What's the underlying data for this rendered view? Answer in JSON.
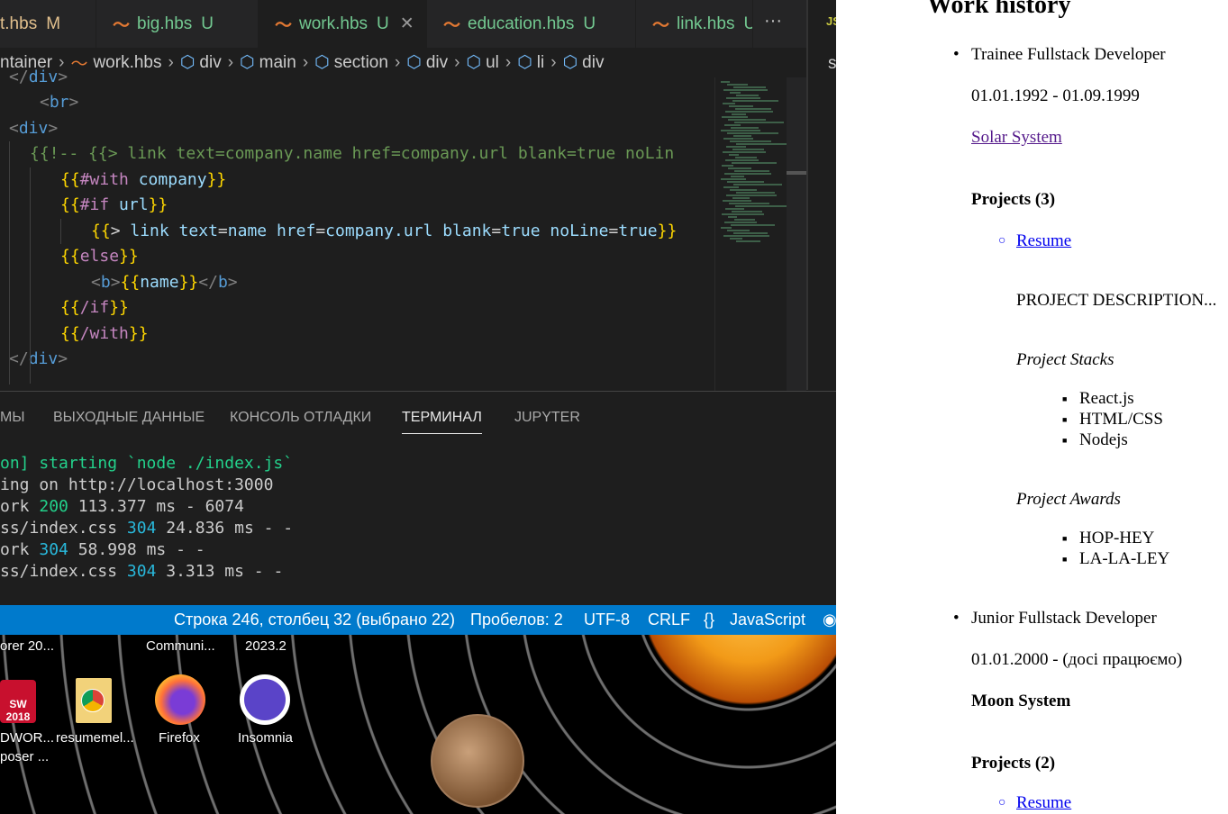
{
  "editor": {
    "tabs": [
      {
        "name": "t.hbs",
        "status": "M",
        "active": false,
        "color": "#e2c08d"
      },
      {
        "name": "big.hbs",
        "status": "U",
        "active": false
      },
      {
        "name": "work.hbs",
        "status": "U",
        "active": true
      },
      {
        "name": "education.hbs",
        "status": "U",
        "active": false
      },
      {
        "name": "link.hbs",
        "status": "U",
        "active": false
      }
    ],
    "more_icon": "ellipsis-icon",
    "close_glyph": "✕",
    "side_label": "JS",
    "side_letter": "s",
    "breadcrumbs": [
      "ntainer",
      "work.hbs",
      "div",
      "main",
      "section",
      "div",
      "ul",
      "li",
      "div"
    ],
    "code_lines": [
      {
        "indent": 1,
        "tokens": [
          [
            "br",
            "</"
          ],
          [
            "tag",
            "div"
          ],
          [
            "br",
            ">"
          ]
        ]
      },
      {
        "indent": 1,
        "tokens": [
          [
            "br",
            "<"
          ],
          [
            "tag",
            "br"
          ],
          [
            "br",
            ">"
          ]
        ]
      },
      {
        "indent": 0,
        "tokens": [
          [
            "br",
            "<"
          ],
          [
            "tag",
            "div"
          ],
          [
            "br",
            ">"
          ]
        ]
      },
      {
        "indent": 1,
        "tokens": [
          [
            "cm",
            "{{!-- {{> link text=company.name href=company.url blank=true noLin"
          ]
        ]
      },
      {
        "indent": 2,
        "tokens": [
          [
            "hb",
            "{{"
          ],
          [
            "kw",
            "#with"
          ],
          [
            "tx",
            " "
          ],
          [
            "id",
            "company"
          ],
          [
            "hb",
            "}}"
          ]
        ]
      },
      {
        "indent": 2,
        "tokens": [
          [
            "hb",
            "{{"
          ],
          [
            "kw",
            "#if"
          ],
          [
            "tx",
            " "
          ],
          [
            "id",
            "url"
          ],
          [
            "hb",
            "}}"
          ]
        ]
      },
      {
        "indent": 3,
        "tokens": [
          [
            "hb",
            "{{"
          ],
          [
            "tx",
            "> "
          ],
          [
            "id",
            "link text"
          ],
          [
            "tx",
            "="
          ],
          [
            "id",
            "name href"
          ],
          [
            "tx",
            "="
          ],
          [
            "id",
            "company.url blank"
          ],
          [
            "tx",
            "="
          ],
          [
            "id",
            "true noLine"
          ],
          [
            "tx",
            "="
          ],
          [
            "id",
            "true"
          ],
          [
            "hb",
            "}}"
          ]
        ]
      },
      {
        "indent": 2,
        "tokens": [
          [
            "hb",
            "{{"
          ],
          [
            "kw",
            "else"
          ],
          [
            "hb",
            "}}"
          ]
        ]
      },
      {
        "indent": 3,
        "tokens": [
          [
            "br",
            "<"
          ],
          [
            "tag",
            "b"
          ],
          [
            "br",
            ">"
          ],
          [
            "hb",
            "{{"
          ],
          [
            "id",
            "name"
          ],
          [
            "hb",
            "}}"
          ],
          [
            "br",
            "</"
          ],
          [
            "tag",
            "b"
          ],
          [
            "br",
            ">"
          ]
        ]
      },
      {
        "indent": 2,
        "tokens": [
          [
            "hb",
            "{{"
          ],
          [
            "kw",
            "/if"
          ],
          [
            "hb",
            "}}"
          ]
        ]
      },
      {
        "indent": 2,
        "tokens": [
          [
            "hb",
            "{{"
          ],
          [
            "kw",
            "/with"
          ],
          [
            "hb",
            "}}"
          ]
        ]
      },
      {
        "indent": 0,
        "tokens": [
          [
            "br",
            "</"
          ],
          [
            "tag",
            "div"
          ],
          [
            "br",
            ">"
          ]
        ]
      }
    ]
  },
  "panel": {
    "tabs": [
      "МЫ",
      "ВЫХОДНЫЕ ДАННЫЕ",
      "КОНСОЛЬ ОТЛАДКИ",
      "ТЕРМИНАЛ",
      "JUPYTER"
    ],
    "active_tab": "ТЕРМИНАЛ",
    "terminal": [
      [
        [
          "g",
          "on] starting `node ./index.js`"
        ]
      ],
      [
        [
          "t",
          "ing on http://localhost:3000"
        ]
      ],
      [
        [
          "t",
          "ork "
        ],
        [
          "g",
          "200"
        ],
        [
          "t",
          " 113.377 ms - 6074"
        ]
      ],
      [
        [
          "t",
          "ss/index.css "
        ],
        [
          "c",
          "304"
        ],
        [
          "t",
          " 24.836 ms - -"
        ]
      ],
      [
        [
          "t",
          "ork "
        ],
        [
          "c",
          "304"
        ],
        [
          "t",
          " 58.998 ms - -"
        ]
      ],
      [
        [
          "t",
          "ss/index.css "
        ],
        [
          "c",
          "304"
        ],
        [
          "t",
          " 3.313 ms - -"
        ]
      ]
    ]
  },
  "status_bar": {
    "position": "Строка 246, столбец 32 (выбрано 22)",
    "spaces": "Пробелов: 2",
    "encoding": "UTF-8",
    "eol": "CRLF",
    "language_icon": "{}",
    "language": "JavaScript"
  },
  "desktop": {
    "top_labels": [
      "orer 20...",
      "Communi...",
      "2023.2"
    ],
    "icons": [
      {
        "label": "DWOR...",
        "label2": "poser ...",
        "badge": "SW 2018"
      },
      {
        "label": "resumemel..."
      },
      {
        "label": "Firefox"
      },
      {
        "label": "Insomnia"
      }
    ]
  },
  "webpage": {
    "title": "Work history",
    "jobs": [
      {
        "position": "Trainee Fullstack Developer",
        "dates": "01.01.1992 - 01.09.1999",
        "company": "Solar System",
        "projects_heading": "Projects (3)",
        "project_link": "Resume",
        "description": "PROJECT DESCRIPTION...",
        "stacks_heading": "Project Stacks",
        "stacks": [
          "React.js",
          "HTML/CSS",
          "Nodejs"
        ],
        "awards_heading": "Project Awards",
        "awards": [
          "HOP-HEY",
          "LA-LA-LEY"
        ]
      },
      {
        "position": "Junior Fullstack Developer",
        "dates": "01.01.2000 - (досі працюємо)",
        "company": "Moon System",
        "projects_heading": "Projects (2)",
        "project_link": "Resume"
      }
    ]
  }
}
